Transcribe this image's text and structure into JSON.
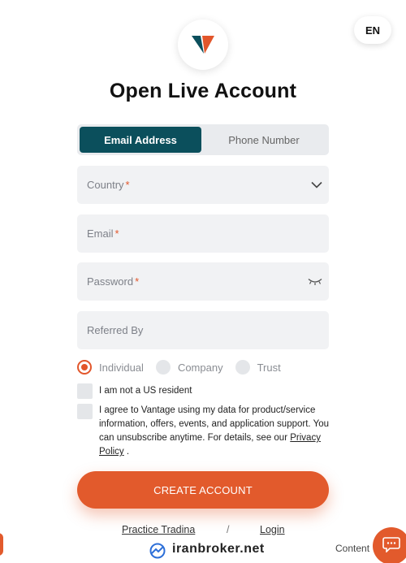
{
  "header": {
    "language": "EN",
    "title": "Open Live Account"
  },
  "tabs": [
    {
      "label": "Email Address",
      "active": true
    },
    {
      "label": "Phone Number",
      "active": false
    }
  ],
  "fields": {
    "country": {
      "placeholder": "Country",
      "required": "*",
      "icon": "chevron-down-icon"
    },
    "email": {
      "placeholder": "Email",
      "required": "*"
    },
    "password": {
      "placeholder": "Password",
      "required": "*",
      "icon": "eye-closed-icon"
    },
    "referred": {
      "placeholder": "Referred By"
    }
  },
  "account_types": [
    {
      "label": "Individual",
      "selected": true
    },
    {
      "label": "Company",
      "selected": false
    },
    {
      "label": "Trust",
      "selected": false
    }
  ],
  "checkboxes": {
    "us_resident": "I am not a US resident",
    "consent_line1": "I agree to Vantage using my data for product/service",
    "consent_line2": "information, offers, events, and application support. You",
    "consent_line3": "can unsubscribe anytime. For details, see our",
    "privacy_link_part1": "Privacy",
    "privacy_link_part2": "Policy",
    "consent_end": "."
  },
  "actions": {
    "create_account": "CREATE ACCOUNT",
    "practice_trading": "Practice Tradina",
    "separator": "/",
    "login": "Login"
  },
  "watermark": {
    "text": "iranbroker.net"
  },
  "widget": {
    "content_label": "Content",
    "icon": "chat-icon"
  },
  "colors": {
    "accent": "#e25a2c",
    "tab_active": "#0b4f5c",
    "field_bg": "#f1f2f4"
  }
}
